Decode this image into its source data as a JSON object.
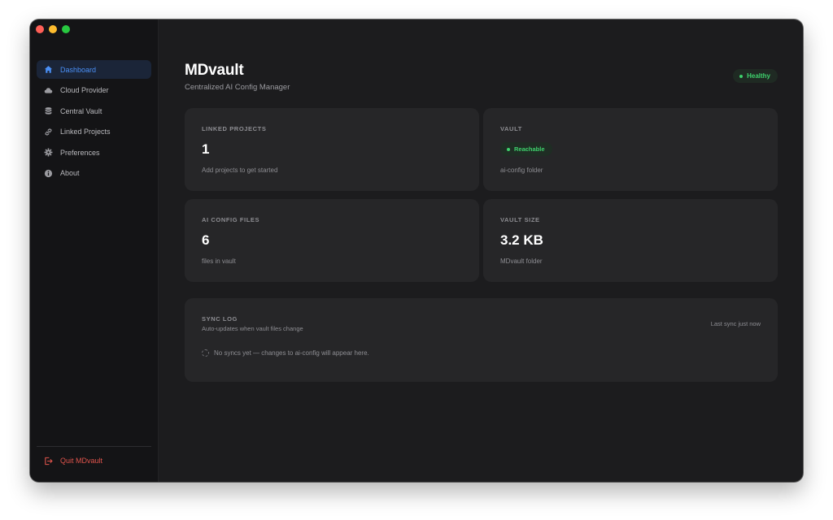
{
  "sidebar": {
    "items": [
      {
        "label": "Dashboard",
        "icon": "home-icon",
        "active": true
      },
      {
        "label": "Cloud Provider",
        "icon": "cloud-icon",
        "active": false
      },
      {
        "label": "Central Vault",
        "icon": "database-icon",
        "active": false
      },
      {
        "label": "Linked Projects",
        "icon": "link-icon",
        "active": false
      },
      {
        "label": "Preferences",
        "icon": "gear-icon",
        "active": false
      },
      {
        "label": "About",
        "icon": "info-icon",
        "active": false
      }
    ],
    "quit_label": "Quit MDvault"
  },
  "header": {
    "title": "MDvault",
    "subtitle": "Centralized AI Config Manager",
    "status": "Healthy"
  },
  "cards": {
    "linked_projects": {
      "label": "LINKED PROJECTS",
      "value": "1",
      "caption": "Add projects to get started"
    },
    "vault": {
      "label": "VAULT",
      "status": "Reachable",
      "caption": "ai-config folder"
    },
    "ai_config_files": {
      "label": "AI CONFIG FILES",
      "value": "6",
      "caption": "files in vault"
    },
    "vault_size": {
      "label": "VAULT SIZE",
      "value": "3.2 KB",
      "caption": "MDvault folder"
    }
  },
  "sync_log": {
    "title": "SYNC LOG",
    "subtitle": "Auto-updates when vault files change",
    "last_sync": "Last sync just now",
    "empty_message": "No syncs yet — changes to ai-config will appear here."
  },
  "colors": {
    "accent": "#4a8ff5",
    "success": "#3ed16c",
    "danger": "#e0544c",
    "background": "#1c1c1e",
    "card": "#262628"
  }
}
